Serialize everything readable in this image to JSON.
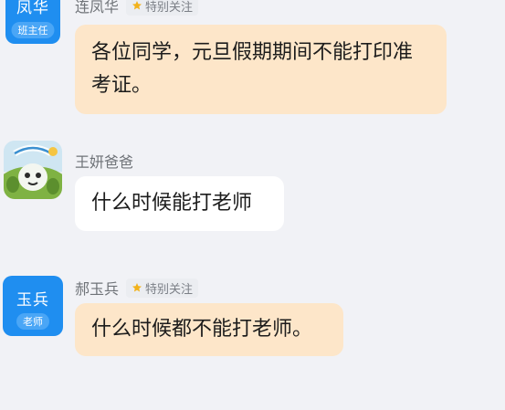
{
  "messages": [
    {
      "sender": "连凤华",
      "badge": "特别关注",
      "avatar": {
        "name": "凤华",
        "role": "班主任"
      },
      "text": "各位同学，元旦假期期间不能打印准考证。"
    },
    {
      "sender": "王妍爸爸",
      "avatar_icon": "cartoon-photo-avatar",
      "text": "什么时候能打老师"
    },
    {
      "sender": "郝玉兵",
      "badge": "特别关注",
      "avatar": {
        "name": "玉兵",
        "role": "老师"
      },
      "text": "什么时候都不能打老师。"
    }
  ],
  "colors": {
    "background": "#f1f2f6",
    "avatar_blue": "#1f8ef0",
    "bubble_peach": "#fde6c9",
    "bubble_white": "#ffffff",
    "star_gold": "#f2b21b"
  }
}
